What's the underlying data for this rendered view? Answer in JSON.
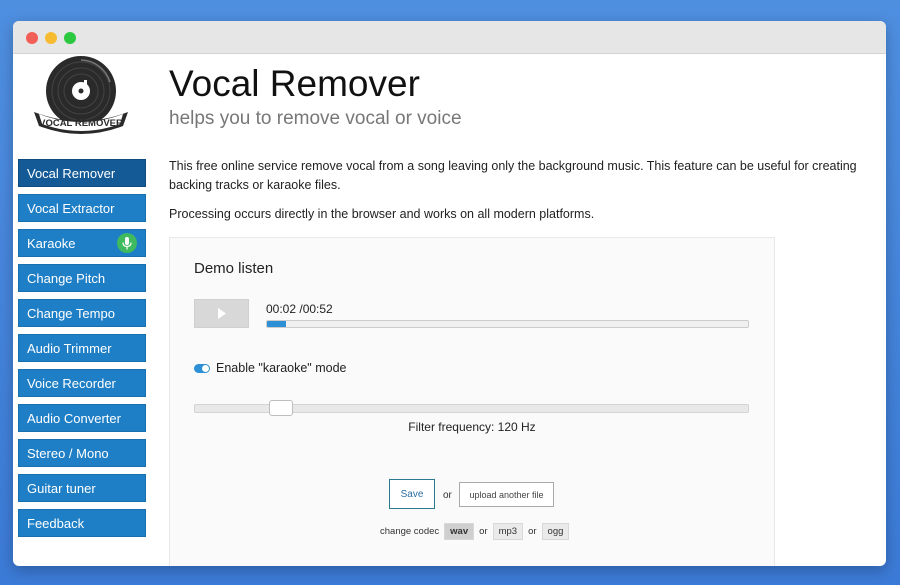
{
  "app": {
    "logo_text": "VOCAL REMOVER",
    "title": "Vocal Remover",
    "subtitle": "helps you to remove vocal or voice",
    "description": "This free online service remove vocal from a song leaving only the background music. This feature can be useful for creating backing tracks or karaoke files.",
    "processing_note": "Processing occurs directly in the browser and works on all modern platforms."
  },
  "sidebar": {
    "items": [
      {
        "label": "Vocal Remover",
        "active": true
      },
      {
        "label": "Vocal Extractor"
      },
      {
        "label": "Karaoke",
        "icon": "microphone-icon"
      },
      {
        "label": "Change Pitch"
      },
      {
        "label": "Change Tempo"
      },
      {
        "label": "Audio Trimmer"
      },
      {
        "label": "Voice Recorder"
      },
      {
        "label": "Audio Converter"
      },
      {
        "label": "Stereo / Mono"
      },
      {
        "label": "Guitar tuner"
      },
      {
        "label": "Feedback"
      }
    ]
  },
  "player": {
    "heading": "Demo listen",
    "time": "00:02 /00:52",
    "progress_fraction": 0.04,
    "karaoke_toggle_label": "Enable \"karaoke\" mode",
    "karaoke_enabled": true,
    "filter_label": "Filter frequency: 120 Hz",
    "filter_slider_fraction": 0.155
  },
  "actions": {
    "save_label": "Save",
    "or_label": "or",
    "upload_label": "upload another file",
    "codec_label": "change codec",
    "codecs": [
      "wav",
      "mp3",
      "ogg"
    ],
    "selected_codec": "wav"
  },
  "colors": {
    "nav_bg": "#1f7fc6",
    "nav_active_bg": "#135a96",
    "accent": "#2d8fd5",
    "mic_badge": "#3fba5f"
  }
}
